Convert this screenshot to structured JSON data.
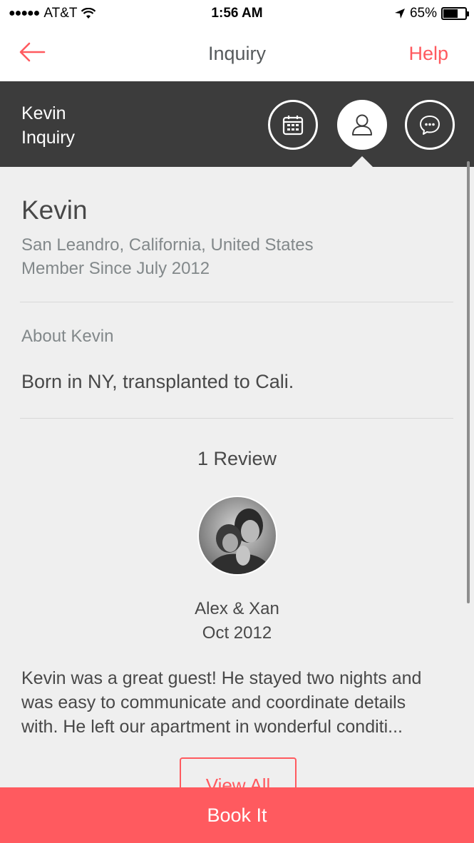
{
  "status_bar": {
    "signal_dots": "●●●●●",
    "carrier": "AT&T",
    "time": "1:56 AM",
    "battery_percent": "65%",
    "battery_level": 0.65
  },
  "nav": {
    "title": "Inquiry",
    "help_label": "Help"
  },
  "header": {
    "name": "Kevin",
    "status": "Inquiry",
    "icons": [
      "calendar-icon",
      "profile-icon",
      "message-icon"
    ],
    "active_tab": "profile"
  },
  "profile": {
    "name": "Kevin",
    "location": "San Leandro, California, United States",
    "member_since": "Member Since July 2012",
    "about_heading": "About Kevin",
    "about_text": "Born in NY, transplanted to Cali."
  },
  "reviews": {
    "count_label": "1 Review",
    "items": [
      {
        "reviewer": "Alex & Xan",
        "date": "Oct 2012",
        "text": "Kevin was a great guest!  He stayed two nights and\nwas easy to communicate and coordinate details\nwith.  He left our apartment in wonderful conditi..."
      }
    ],
    "view_all_label": "View All"
  },
  "footer": {
    "book_label": "Book It"
  },
  "colors": {
    "accent": "#ff5a5f",
    "header_bg": "#3c3c3c",
    "page_bg": "#efefef"
  }
}
